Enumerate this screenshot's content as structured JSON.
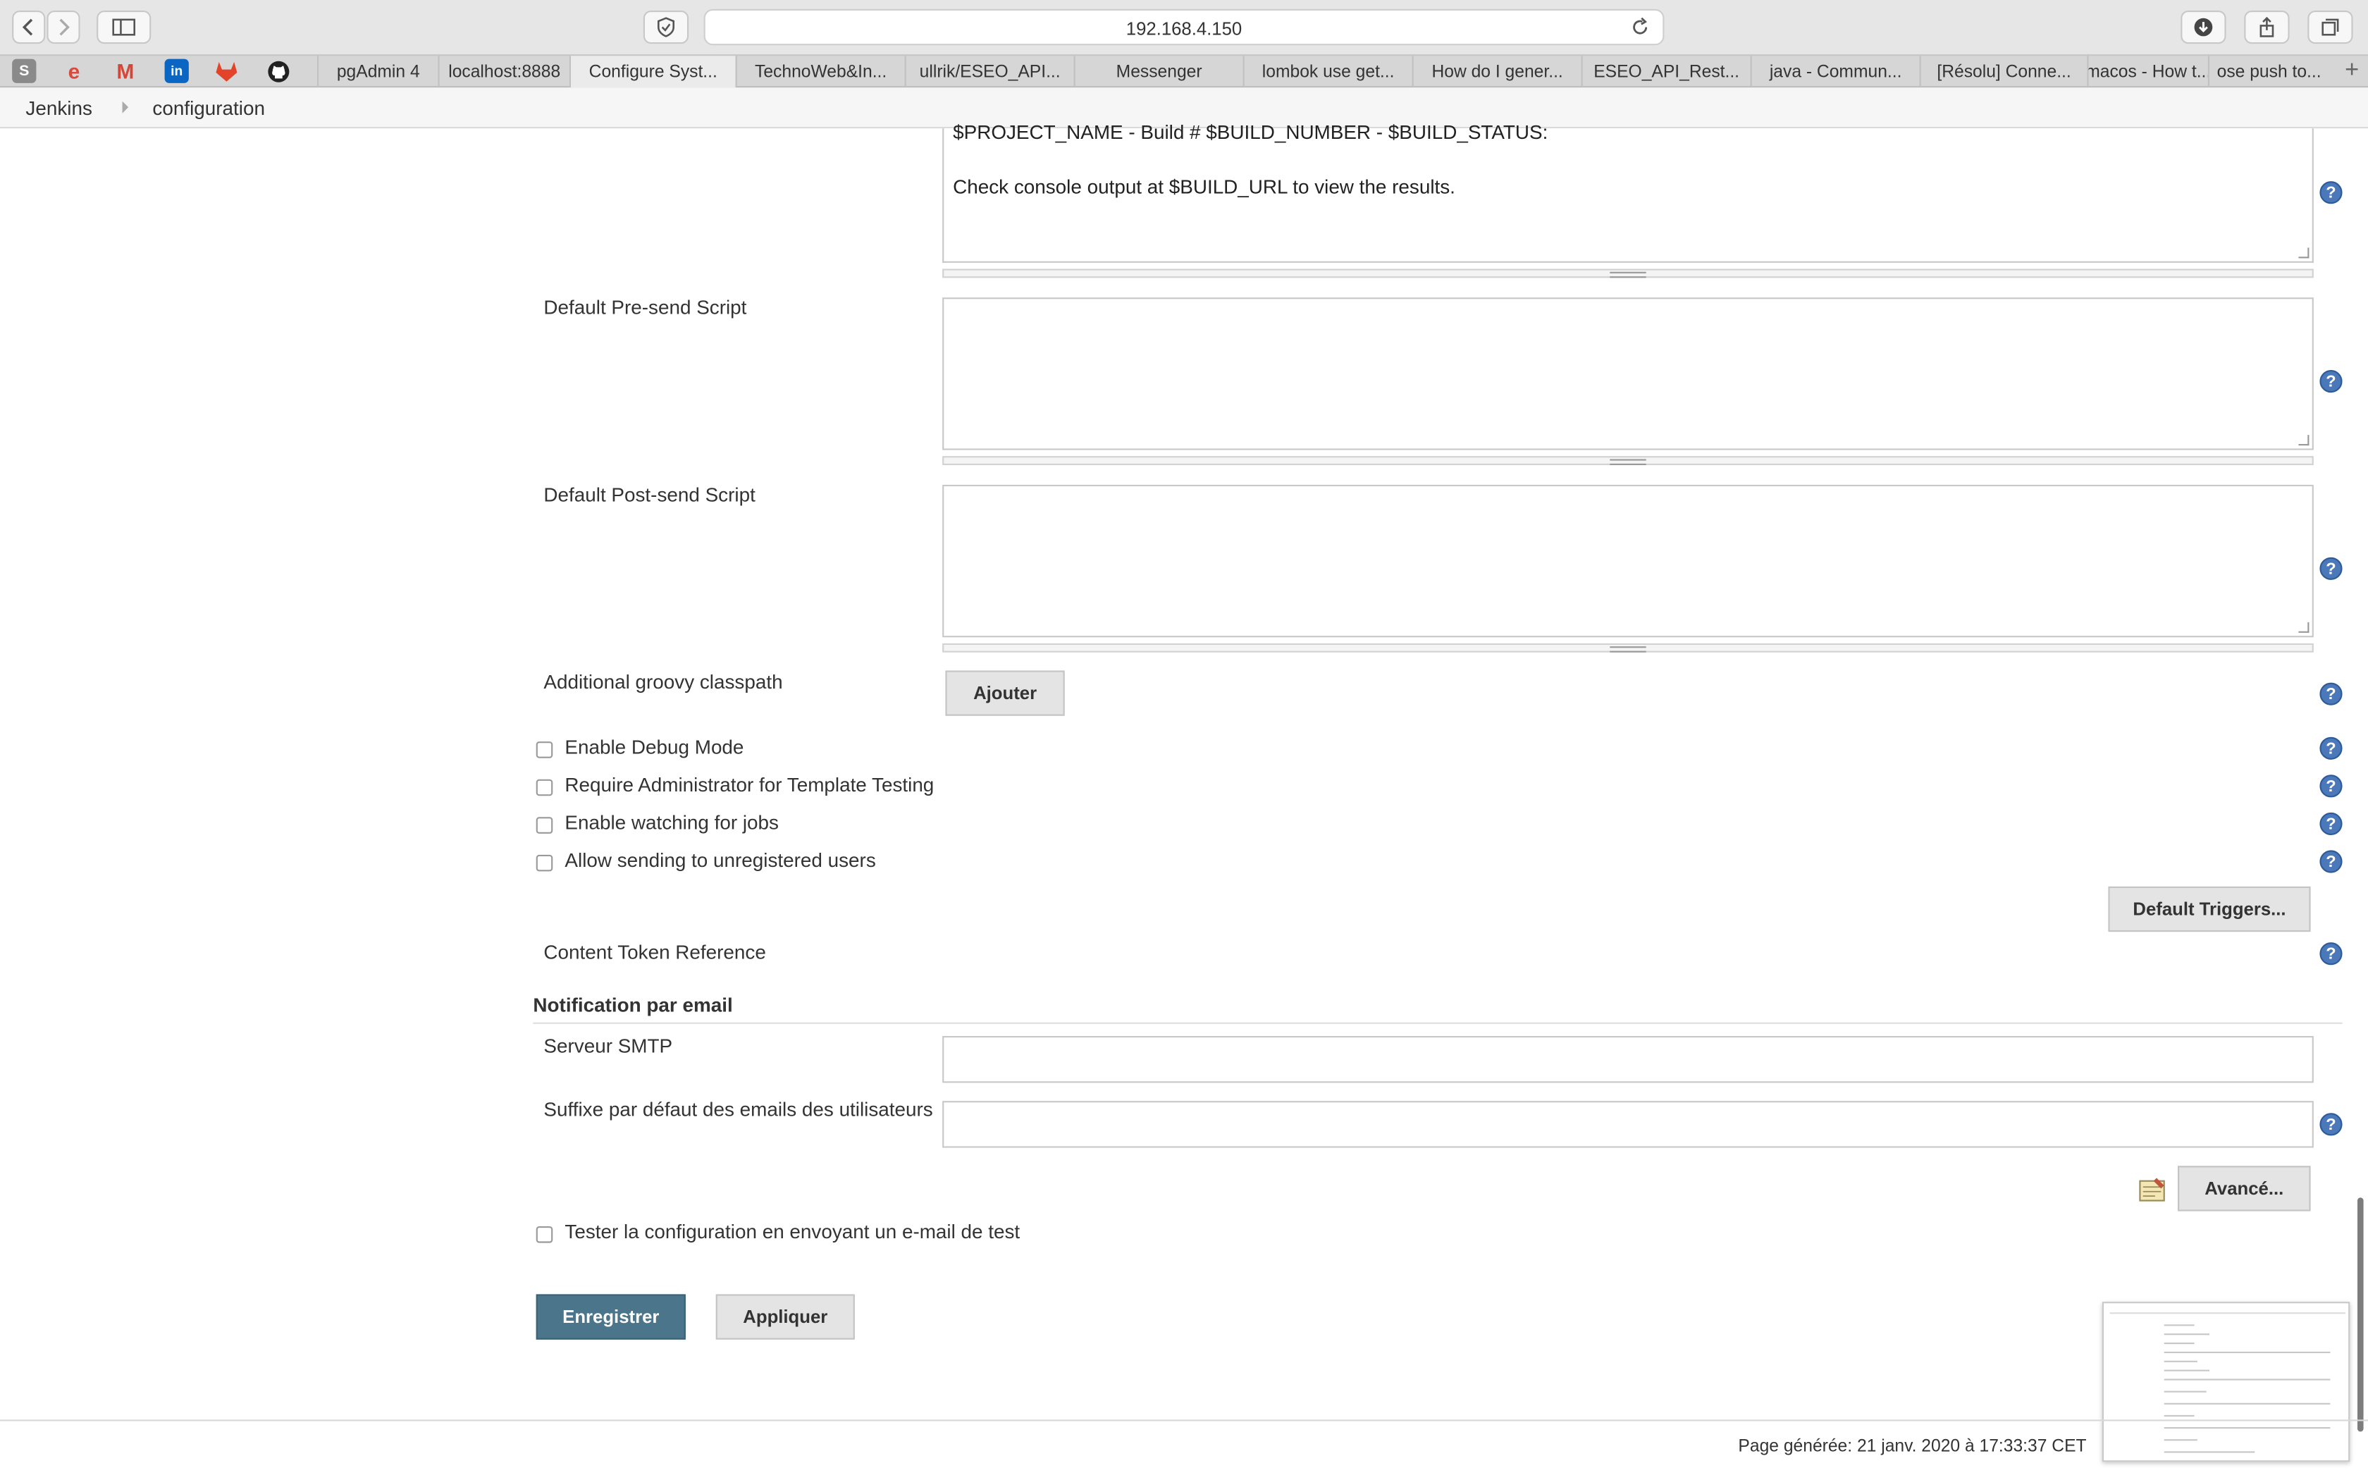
{
  "browser": {
    "url": "192.168.4.150",
    "tabs": [
      {
        "label": "pgAdmin 4",
        "active": false
      },
      {
        "label": "localhost:8888",
        "active": false
      },
      {
        "label": "Configure Syst...",
        "active": true
      },
      {
        "label": "TechnoWeb&In...",
        "active": false
      },
      {
        "label": "ullrik/ESEO_API...",
        "active": false
      },
      {
        "label": "Messenger",
        "active": false
      },
      {
        "label": "lombok use get...",
        "active": false
      },
      {
        "label": "How do I gener...",
        "active": false
      },
      {
        "label": "ESEO_API_Rest...",
        "active": false
      },
      {
        "label": "java - Commun...",
        "active": false
      },
      {
        "label": "[Résolu] Conne...",
        "active": false
      },
      {
        "label": "macos - How t...",
        "active": false
      },
      {
        "label": "ose push to...",
        "active": false
      }
    ],
    "bookmarks": [
      "S",
      "e",
      "M",
      "in",
      "gitlab",
      "github"
    ]
  },
  "breadcrumb": {
    "home": "Jenkins",
    "page": "configuration"
  },
  "form": {
    "default_content_line1": "$PROJECT_NAME - Build # $BUILD_NUMBER - $BUILD_STATUS:",
    "default_content_line2": "Check console output at $BUILD_URL to view the results.",
    "pre_send_label": "Default Pre-send Script",
    "post_send_label": "Default Post-send Script",
    "groovy_label": "Additional groovy classpath",
    "add_button": "Ajouter",
    "checkboxes": [
      {
        "label": "Enable Debug Mode",
        "checked": false
      },
      {
        "label": "Require Administrator for Template Testing",
        "checked": false
      },
      {
        "label": "Enable watching for jobs",
        "checked": false
      },
      {
        "label": "Allow sending to unregistered users",
        "checked": false
      }
    ],
    "default_triggers_button": "Default Triggers...",
    "content_token_label": "Content Token Reference",
    "notification_title": "Notification par email",
    "smtp_label": "Serveur SMTP",
    "smtp_value": "",
    "suffix_label": "Suffixe par défaut des emails des utilisateurs",
    "suffix_value": "",
    "advanced_button": "Avancé...",
    "test_label": "Tester la configuration en envoyant un e-mail de test",
    "save_button": "Enregistrer",
    "apply_button": "Appliquer",
    "help_glyph": "?"
  },
  "footer": {
    "generated": "Page générée: 21 janv. 2020 à 17:33:37 CET"
  },
  "colors": {
    "primary_button": "#4b758b",
    "help_icon": "#4a78b8"
  }
}
